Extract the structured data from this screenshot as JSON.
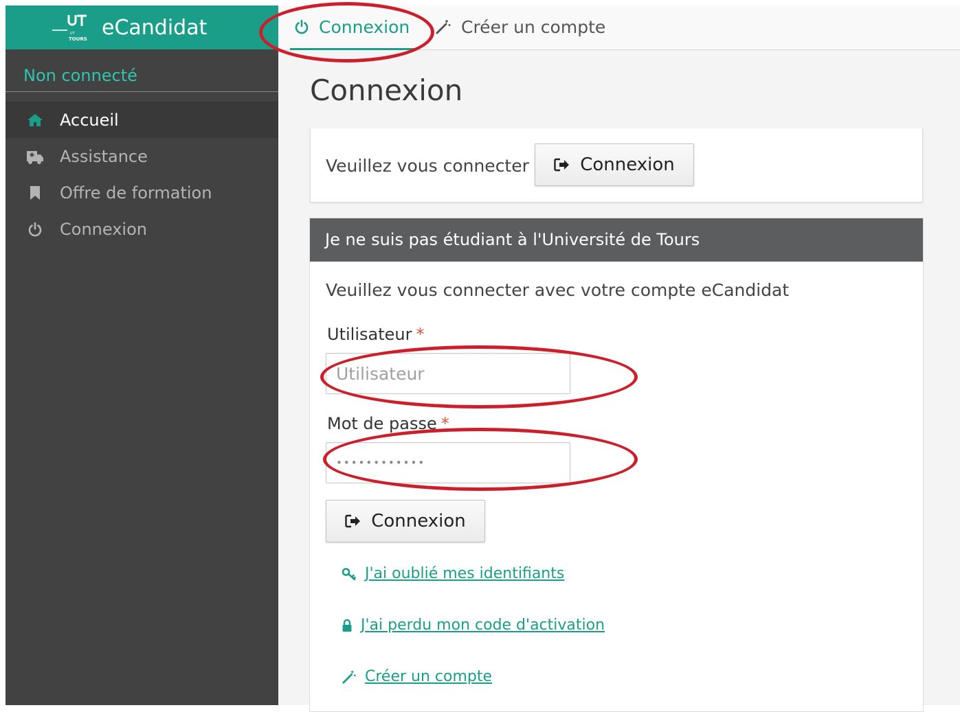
{
  "brand": {
    "title": "eCandidat",
    "logo_text_top": "UT",
    "logo_text_bottom": "TOURS"
  },
  "sidebar": {
    "user_status": "Non connecté",
    "items": [
      {
        "label": "Accueil",
        "icon": "home-icon",
        "active": true
      },
      {
        "label": "Assistance",
        "icon": "ambulance-icon",
        "active": false
      },
      {
        "label": "Offre de formation",
        "icon": "bookmark-icon",
        "active": false
      },
      {
        "label": "Connexion",
        "icon": "power-icon",
        "active": false
      }
    ]
  },
  "topbar": {
    "tabs": [
      {
        "label": "Connexion",
        "icon": "power-icon",
        "active": true
      },
      {
        "label": "Créer un compte",
        "icon": "magic-wand-icon",
        "active": false
      }
    ]
  },
  "main": {
    "title": "Connexion",
    "panel1": {
      "text": "Veuillez vous connecter",
      "button_label": "Connexion"
    },
    "panel2": {
      "header": "Je ne suis pas étudiant à l'Université de Tours",
      "intro": "Veuillez vous connecter avec votre compte eCandidat",
      "username_label": "Utilisateur",
      "username_placeholder": "Utilisateur",
      "username_value": "",
      "password_label": "Mot de passe",
      "password_value": "••••••••••••",
      "required_mark": "*",
      "submit_label": "Connexion",
      "links": [
        {
          "label": "J'ai oublié mes identifiants",
          "icon": "key-icon"
        },
        {
          "label": "J'ai perdu mon code d'activation",
          "icon": "lock-icon"
        },
        {
          "label": "Créer un compte",
          "icon": "magic-wand-icon"
        }
      ]
    }
  },
  "colors": {
    "accent": "#1a9e89",
    "sidebar_bg": "#424242",
    "panel_header_bg": "#5b5d5f",
    "required": "#e0533b",
    "annotation": "#cc1f2b"
  }
}
